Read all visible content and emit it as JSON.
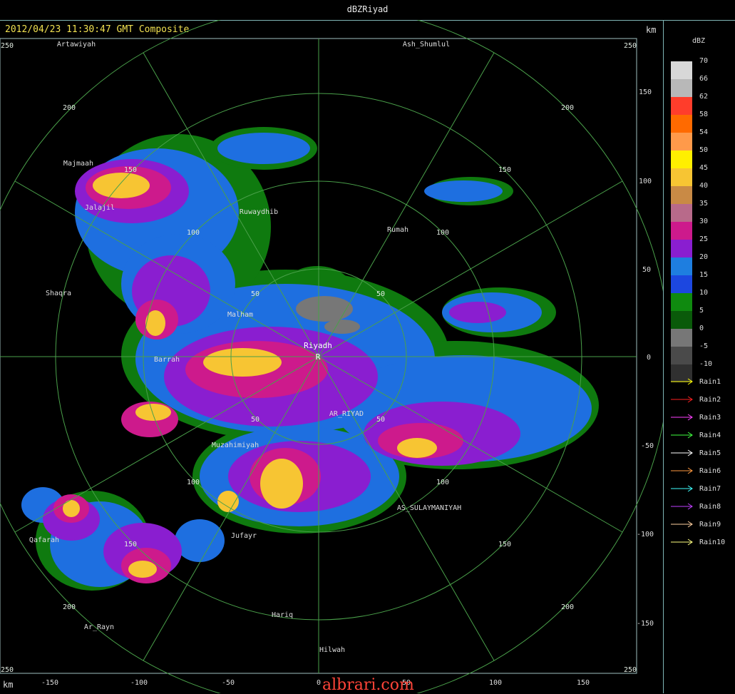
{
  "window": {
    "title": "dBZRiyad"
  },
  "header": {
    "subtitle": "2012/04/23 11:30:47 GMT Composite",
    "km_top": "km",
    "km_bottom": "km"
  },
  "legend": {
    "unit": "dBZ",
    "scale": [
      {
        "label": "70",
        "color": "#d8d8d8"
      },
      {
        "label": "66",
        "color": "#b8b8b8"
      },
      {
        "label": "62",
        "color": "#ff3d2b"
      },
      {
        "label": "58",
        "color": "#ff6a00"
      },
      {
        "label": "54",
        "color": "#ff9a4a"
      },
      {
        "label": "50",
        "color": "#ffef00"
      },
      {
        "label": "45",
        "color": "#f7c533"
      },
      {
        "label": "40",
        "color": "#c98a45"
      },
      {
        "label": "35",
        "color": "#b86a8a"
      },
      {
        "label": "30",
        "color": "#cd1a8c"
      },
      {
        "label": "25",
        "color": "#8a1ed0"
      },
      {
        "label": "20",
        "color": "#1e7ee0"
      },
      {
        "label": "15",
        "color": "#1c47e0"
      },
      {
        "label": "10",
        "color": "#0f8a0f"
      },
      {
        "label": "5",
        "color": "#0a5a0a"
      },
      {
        "label": "0",
        "color": "#777777"
      },
      {
        "label": "-5",
        "color": "#4a4a4a"
      },
      {
        "label": "-10",
        "color": "#303030"
      }
    ],
    "tracks": [
      {
        "label": "Rain1",
        "color": "#ffff00"
      },
      {
        "label": "Rain2",
        "color": "#ff2020"
      },
      {
        "label": "Rain3",
        "color": "#ff40ff"
      },
      {
        "label": "Rain4",
        "color": "#40ff40"
      },
      {
        "label": "Rain5",
        "color": "#ffffff"
      },
      {
        "label": "Rain6",
        "color": "#ff9a40"
      },
      {
        "label": "Rain7",
        "color": "#40ffff"
      },
      {
        "label": "Rain8",
        "color": "#c040ff"
      },
      {
        "label": "Rain9",
        "color": "#ffd0a0"
      },
      {
        "label": "Rain10",
        "color": "#ffff80"
      }
    ]
  },
  "axes": {
    "x_ticks": [
      "-150",
      "-100",
      "-50",
      "0",
      "50",
      "100",
      "150"
    ],
    "y_ticks": [
      "150",
      "100",
      "50",
      "0",
      "-50",
      "-100",
      "-150"
    ],
    "corner_labels": [
      "250",
      "250",
      "250",
      "250"
    ]
  },
  "range_rings": {
    "ring50": [
      "50",
      "50",
      "50",
      "50"
    ],
    "ring100": [
      "100",
      "100",
      "100",
      "100"
    ],
    "ring150": [
      "150",
      "150",
      "150",
      "150"
    ],
    "ring200": [
      "200",
      "200",
      "200",
      "200"
    ]
  },
  "radar": {
    "name": "Riyadh",
    "marker": "R"
  },
  "cities": [
    {
      "name": "Artawiyah"
    },
    {
      "name": "Ash_Shumlul"
    },
    {
      "name": "Majmaah"
    },
    {
      "name": "Jalajil"
    },
    {
      "name": "Ruwaydhib"
    },
    {
      "name": "Rumah"
    },
    {
      "name": "Shaqra"
    },
    {
      "name": "Malham"
    },
    {
      "name": "Barrah"
    },
    {
      "name": "AR_RIYAD"
    },
    {
      "name": "Muzahimiyah"
    },
    {
      "name": "AS_SULAYMANIYAH"
    },
    {
      "name": "Qafarah"
    },
    {
      "name": "Jufayr"
    },
    {
      "name": "Hariq"
    },
    {
      "name": "Ar_Rayn"
    },
    {
      "name": "Hilwah"
    }
  ],
  "watermark": "albrari.com"
}
